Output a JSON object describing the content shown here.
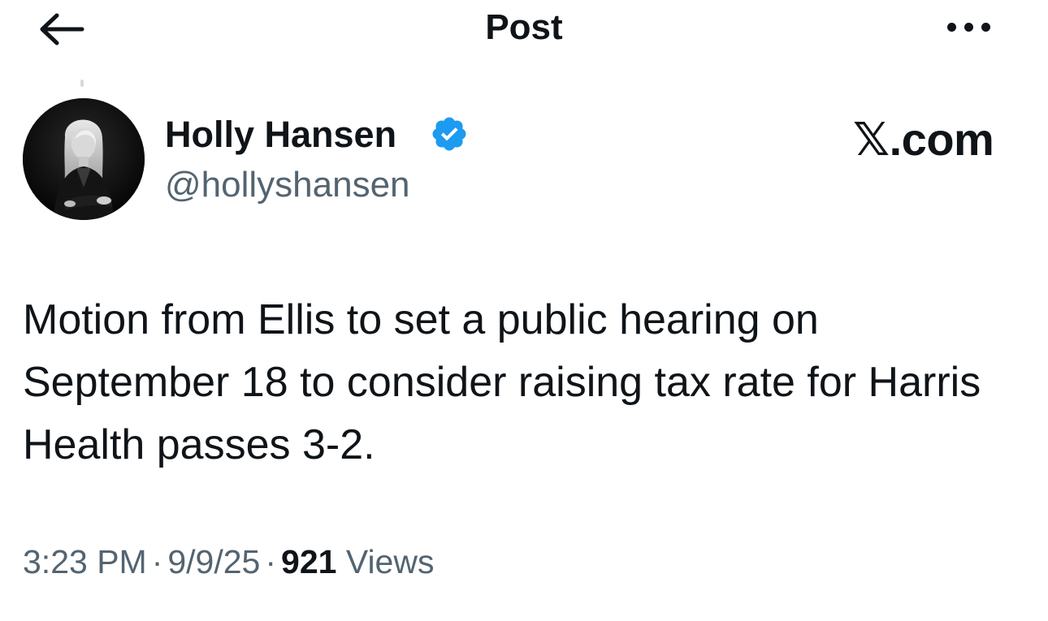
{
  "header": {
    "title": "Post",
    "back_icon": "arrow-left-icon",
    "more_icon": "more-horizontal-icon"
  },
  "author": {
    "display_name": "Holly Hansen",
    "handle": "@hollyshansen",
    "verified": true,
    "verified_color": "#1d9bf0"
  },
  "brand": {
    "label": "𝕏.com"
  },
  "tweet": {
    "text": "Motion from Ellis to set a public hearing on September 18 to consider raising tax rate for Harris Health passes 3-2."
  },
  "meta": {
    "time": "3:23 PM",
    "separator": "·",
    "date": "9/9/25",
    "views_count": "921",
    "views_label": "Views"
  }
}
